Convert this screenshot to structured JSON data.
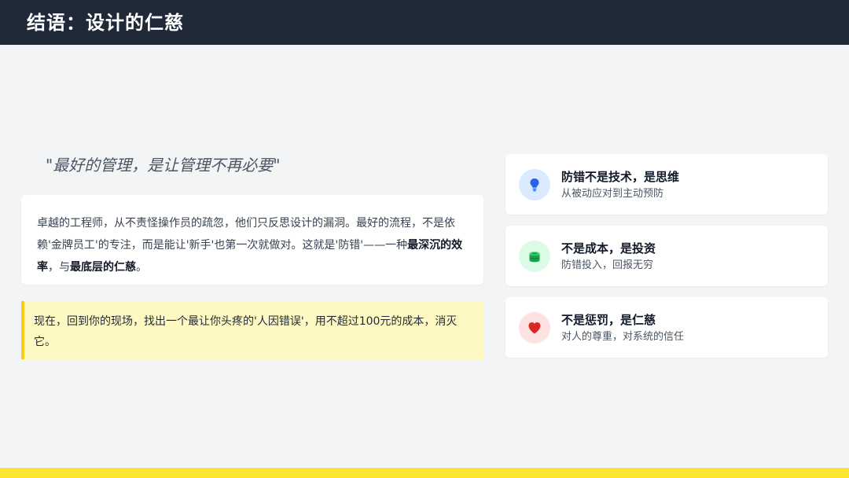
{
  "header": {
    "title": "结语：设计的仁慈"
  },
  "quote": "\"最好的管理，是让管理不再必要\"",
  "main_card": {
    "text_1": "卓越的工程师，从不责怪操作员的疏忽，他们只反思设计的漏洞。最好的流程，不是依赖'金牌员工'的专注，而是能让'新手'也第一次就做对。这就是'防错'——一种",
    "bold_1": "最深沉的效率",
    "text_2": "，与",
    "bold_2": "最底层的仁慈",
    "text_3": "。"
  },
  "callout": {
    "text": "现在，回到你的现场，找出一个最让你头疼的'人因错误'，用不超过100元的成本，消灭它。"
  },
  "points": [
    {
      "title": "防错不是技术，是思维",
      "subtitle": "从被动应对到主动预防",
      "icon": "lightbulb-icon",
      "icon_bg": "#dbeafe",
      "icon_color": "#2563eb"
    },
    {
      "title": "不是成本，是投资",
      "subtitle": "防错投入，回报无穷",
      "icon": "coins-icon",
      "icon_bg": "#dcfce7",
      "icon_color": "#16a34a"
    },
    {
      "title": "不是惩罚，是仁慈",
      "subtitle": "对人的尊重，对系统的信任",
      "icon": "heart-icon",
      "icon_bg": "#fee2e2",
      "icon_color": "#dc2626"
    }
  ],
  "colors": {
    "header_bg": "#1f2937",
    "accent_yellow": "#fde62f"
  }
}
